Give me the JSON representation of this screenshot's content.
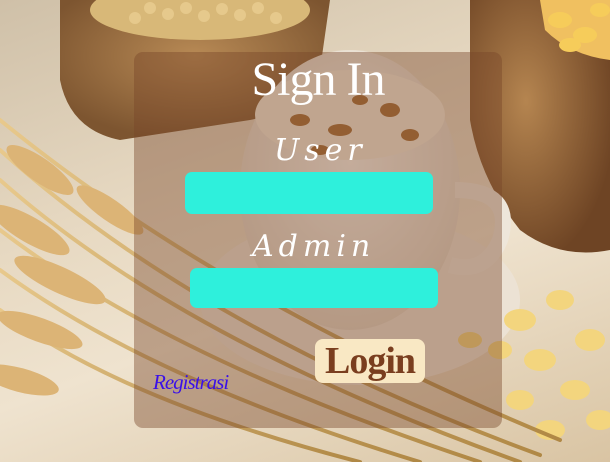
{
  "form": {
    "title": "Sign In",
    "user_label": "User",
    "user_value": "",
    "admin_label": "Admin",
    "admin_value": "",
    "login_label": "Login",
    "register_label": "Registrasi"
  },
  "colors": {
    "panel": "#78462a",
    "input_bg": "#2ef0dc",
    "login_bg": "#f9e8c4",
    "login_text": "#7a3e1f",
    "link": "#3a10e8",
    "label": "#ffffff"
  }
}
